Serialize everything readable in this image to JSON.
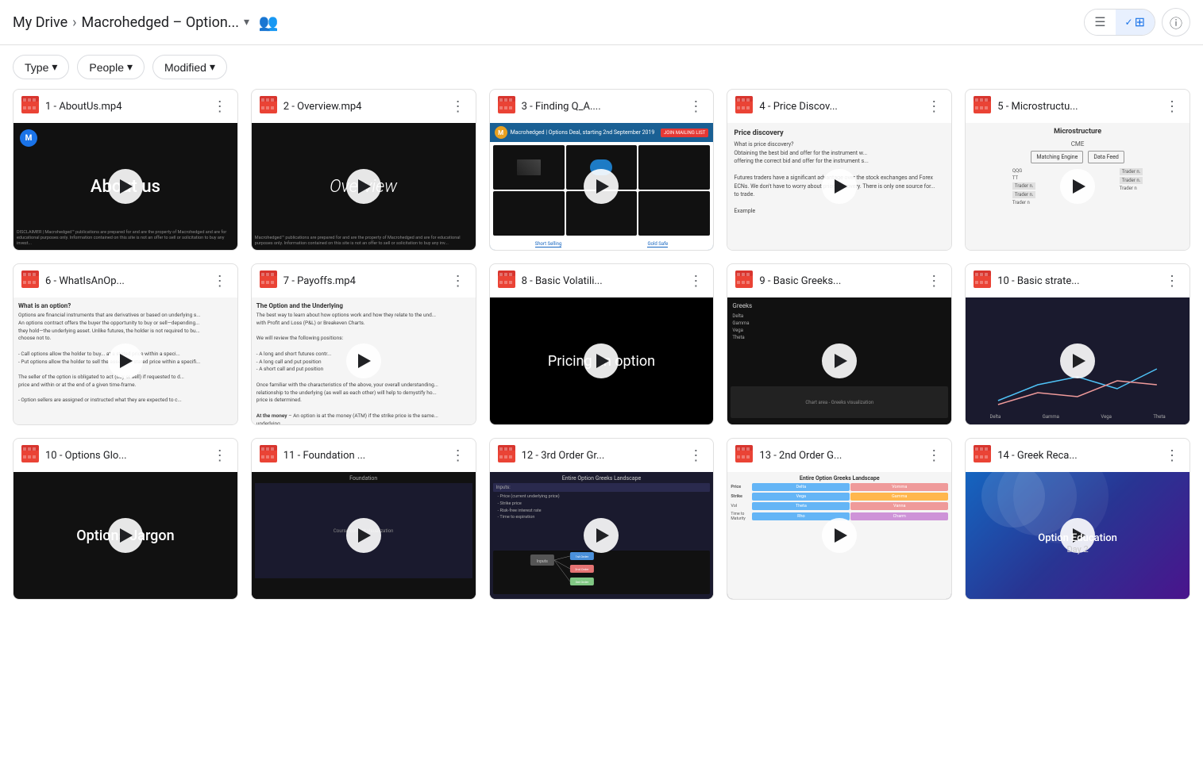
{
  "header": {
    "my_drive_label": "My Drive",
    "breadcrumb_sep": ">",
    "current_folder": "Macrohedged – Option...",
    "people_icon": "👥",
    "list_view_icon": "☰",
    "grid_view_icon": "⊞",
    "check_icon": "✓",
    "info_icon": "ℹ"
  },
  "filters": {
    "type_label": "Type",
    "people_label": "People",
    "modified_label": "Modified",
    "chevron": "▾"
  },
  "videos": [
    {
      "id": 1,
      "title": "1 - AboutUs.mp4",
      "thumb_text": "About us",
      "thumb_class": "thumb-1",
      "has_play": true,
      "has_disclaimer": true
    },
    {
      "id": 2,
      "title": "2 - Overview.mp4",
      "thumb_text": "Overview",
      "thumb_class": "thumb-2",
      "has_play": true,
      "has_disclaimer": true
    },
    {
      "id": 3,
      "title": "3 - Finding Q_A....",
      "thumb_text": "",
      "thumb_class": "thumb-3",
      "has_play": true,
      "has_disclaimer": false,
      "is_light": true
    },
    {
      "id": 4,
      "title": "4 - Price Discov...",
      "thumb_text": "Price discovery\nWhat is price discovery?\nObtaining the best bid and offer for the instrument w...",
      "thumb_class": "thumb-4",
      "has_play": true,
      "has_disclaimer": false,
      "is_light": true
    },
    {
      "id": 5,
      "title": "5 - Microstructu...",
      "thumb_text": "Microstructure",
      "thumb_class": "thumb-5",
      "has_play": true,
      "has_disclaimer": false,
      "is_light": true
    },
    {
      "id": 6,
      "title": "6 - WhatIsAnOp...",
      "thumb_text": "What is an option?\nOptions are financial instruments...",
      "thumb_class": "thumb-6",
      "has_play": true,
      "has_disclaimer": false,
      "is_light": true
    },
    {
      "id": 7,
      "title": "7 - Payoffs.mp4",
      "thumb_text": "The Option and the Underlying\nThe best way to learn about how options work...",
      "thumb_class": "thumb-7",
      "has_play": true,
      "has_disclaimer": false,
      "is_light": true
    },
    {
      "id": 8,
      "title": "8 - Basic Volatili...",
      "thumb_text": "Pricing an option",
      "thumb_class": "thumb-8",
      "has_play": true,
      "has_disclaimer": false
    },
    {
      "id": 9,
      "title": "9 - Basic Greeks...",
      "thumb_text": "",
      "thumb_class": "thumb-9",
      "has_play": true,
      "has_disclaimer": false
    },
    {
      "id": 10,
      "title": "10 - Basic strate...",
      "thumb_text": "",
      "thumb_class": "thumb-10a",
      "has_play": true,
      "has_disclaimer": false
    },
    {
      "id": 11,
      "title": "10 - Options Glo...",
      "thumb_text": "Options Jargon",
      "thumb_class": "thumb-10b",
      "has_play": true,
      "has_disclaimer": false
    },
    {
      "id": 12,
      "title": "11 - Foundation ...",
      "thumb_text": "",
      "thumb_class": "thumb-11",
      "has_play": true,
      "has_disclaimer": false
    },
    {
      "id": 13,
      "title": "12 - 3rd Order Gr...",
      "thumb_text": "",
      "thumb_class": "thumb-12",
      "has_play": true,
      "has_disclaimer": false
    },
    {
      "id": 14,
      "title": "13 - 2nd Order G...",
      "thumb_text": "",
      "thumb_class": "thumb-13",
      "has_play": true,
      "has_disclaimer": false,
      "is_light": true
    },
    {
      "id": 15,
      "title": "14 - Greek Reca...",
      "thumb_text": "Option Education\nDay 2",
      "thumb_class": "thumb-14",
      "has_play": true,
      "has_disclaimer": false
    }
  ]
}
